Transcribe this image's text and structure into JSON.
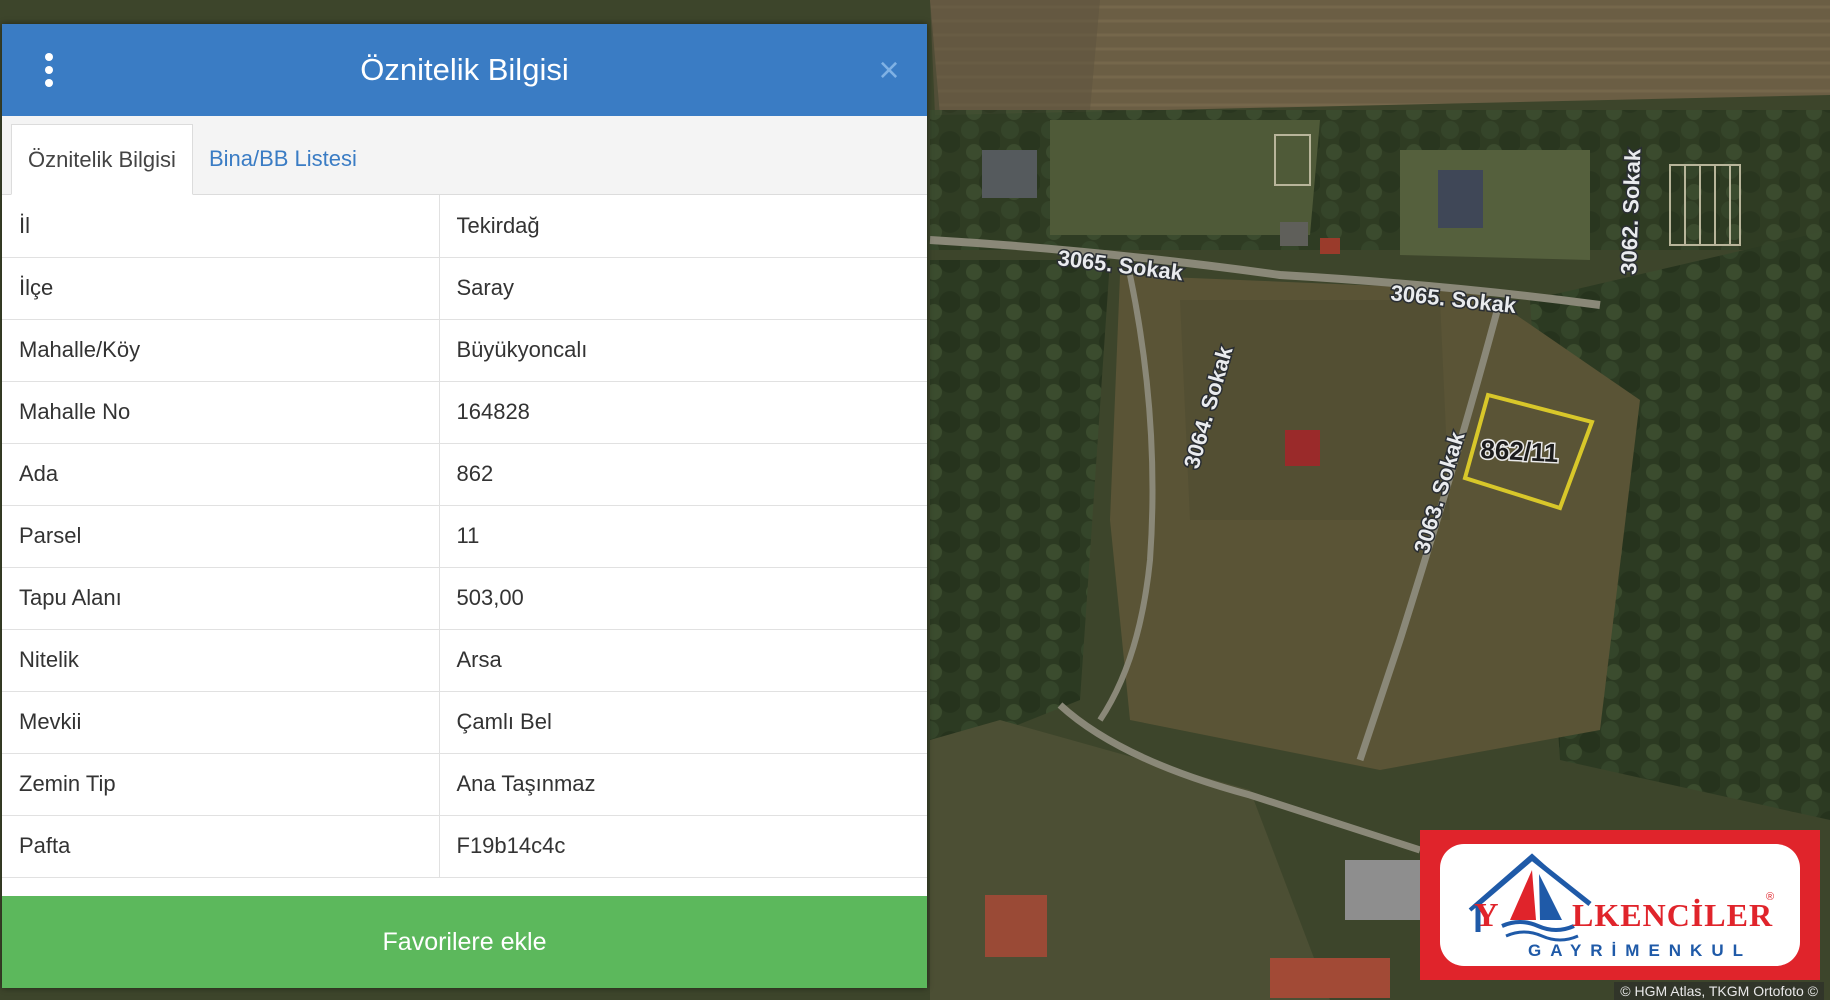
{
  "panel": {
    "title": "Öznitelik Bilgisi",
    "close_symbol": "×",
    "menu_icon": "vertical-ellipsis-icon",
    "tabs": [
      {
        "label": "Öznitelik Bilgisi",
        "active": true
      },
      {
        "label": "Bina/BB Listesi",
        "active": false
      }
    ],
    "rows": [
      {
        "key": "İl",
        "value": "Tekirdağ"
      },
      {
        "key": "İlçe",
        "value": "Saray"
      },
      {
        "key": "Mahalle/Köy",
        "value": "Büyükyoncalı"
      },
      {
        "key": "Mahalle No",
        "value": "164828"
      },
      {
        "key": "Ada",
        "value": "862"
      },
      {
        "key": "Parsel",
        "value": "11"
      },
      {
        "key": "Tapu Alanı",
        "value": "503,00"
      },
      {
        "key": "Nitelik",
        "value": "Arsa"
      },
      {
        "key": "Mevkii",
        "value": "Çamlı Bel"
      },
      {
        "key": "Zemin Tip",
        "value": "Ana Taşınmaz"
      },
      {
        "key": "Pafta",
        "value": "F19b14c4c"
      }
    ],
    "favorite_button": "Favorilere ekle"
  },
  "map": {
    "streets": [
      "3065. Sokak",
      "3065. Sokak",
      "3064. Sokak",
      "3063. Sokak",
      "3062. Sokak"
    ],
    "parcel_label": "862/11",
    "credit": "© HGM Atlas, TKGM Ortofoto ©"
  },
  "logo": {
    "name_left": "Y",
    "name_right": "LKENCİLER",
    "subtitle": "GAYRİMENKUL",
    "registered": "®"
  },
  "colors": {
    "header": "#3a7cc4",
    "favorite": "#5cb85c",
    "parcel_outline": "#d8c72a",
    "logo_red": "#e0242b",
    "logo_blue": "#1f5aa8"
  }
}
